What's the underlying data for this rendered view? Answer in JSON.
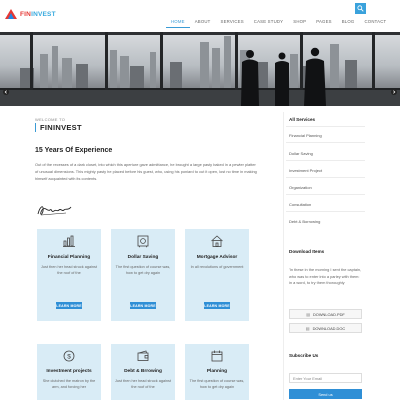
{
  "header": {
    "logo_prefix": "FIN",
    "logo_suffix": "INVEST",
    "nav": [
      "HOME",
      "ABOUT",
      "SERVICES",
      "CASE STUDY",
      "SHOP",
      "PAGES",
      "BLOG",
      "CONTACT"
    ],
    "active_nav": "HOME",
    "search_icon": "search-icon"
  },
  "hero": {
    "prev_icon": "chevron-left-icon",
    "next_icon": "chevron-right-icon"
  },
  "intro": {
    "welcome": "WELCOME TO",
    "brand": "FININVEST",
    "heading": "15 Years Of Experience",
    "paragraph": "Out of the recesses of a dark closet, into which this aperture gave admittance, he brought a large pasty baked in a pewter platter of unusual dimensions. This mighty pasty he placed before his guest, who, using his poniard to cut it open, lost no time in making himself acquainted with its contents."
  },
  "services": [
    {
      "title": "Financial Planning",
      "desc": "Just then her head struck against the roof of the",
      "button": "LEARN MORE",
      "icon": "bar-chart-icon"
    },
    {
      "title": "Dollar Saving",
      "desc": "The first question of course was, how to get dry again",
      "button": "LEARN MORE",
      "icon": "safe-icon"
    },
    {
      "title": "Mortgage Advisor",
      "desc": "In all revolutions of government",
      "button": "LEARN MORE",
      "icon": "house-icon"
    },
    {
      "title": "Investment projects",
      "desc": "She clutched the matron by the arm, and forcing her",
      "button": "LEARN MORE",
      "icon": "coin-icon"
    },
    {
      "title": "Debt & Brrowing",
      "desc": "Just then her head struck against the roof of the",
      "button": "LEARN MORE",
      "icon": "wallet-icon"
    },
    {
      "title": "Planning",
      "desc": "The first question of course was, how to get dry again",
      "button": "LEARN MORE",
      "icon": "calendar-icon"
    }
  ],
  "sidebar": {
    "services_heading": "All Services",
    "services": [
      "Financial Planning",
      "Dollar Saving",
      "Investment Project",
      "Organization",
      "Consultation",
      "Debt & Borrowing"
    ],
    "download_heading": "Download Items",
    "download_text": "'In these in the morning I sent the captain, who was to enter into a parley with them: in a word, to try them thoroughly",
    "download_pdf": "DOWNLOAD.PDF",
    "download_doc": "DOWNLOAD.DOC",
    "subscribe_heading": "Subscribe Us",
    "email_placeholder": "Enter Your Email",
    "send_label": "Send us"
  },
  "colors": {
    "accent": "#2f8fd6",
    "card_bg": "#d9ecf6",
    "logo_red": "#e53935"
  }
}
